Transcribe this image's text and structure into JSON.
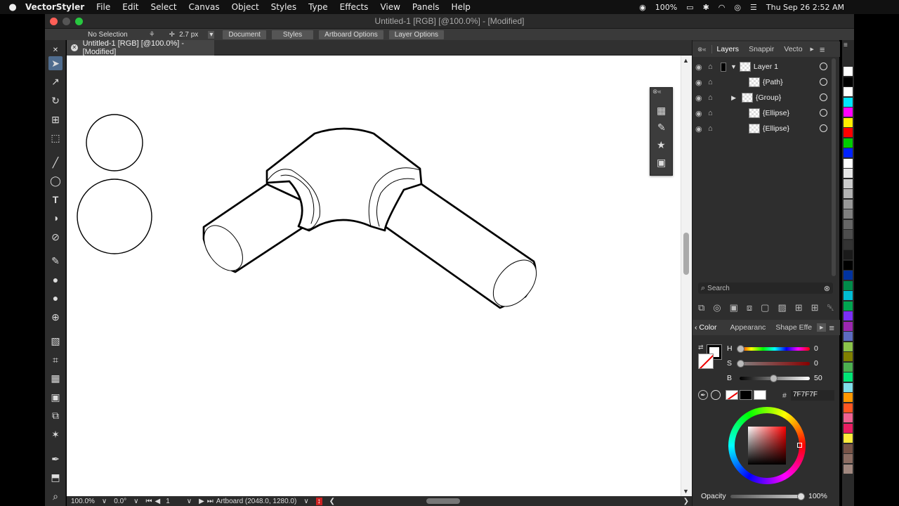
{
  "menubar": {
    "apple": "",
    "items": [
      "VectorStyler",
      "File",
      "Edit",
      "Select",
      "Canvas",
      "Object",
      "Styles",
      "Type",
      "Effects",
      "View",
      "Panels",
      "Help"
    ],
    "battery": "100%",
    "clock": "Thu Sep 26  2:52 AM"
  },
  "window": {
    "title": "Untitled-1 [RGB] [@100.0%] - [Modified]"
  },
  "controlbar": {
    "selection": "No Selection",
    "stroke_width": "2.7 px",
    "buttons": [
      "Document",
      "Styles",
      "Artboard Options",
      "Layer Options"
    ]
  },
  "document_tab": {
    "label": "Untitled-1 [RGB] [@100.0%] - [Modified]"
  },
  "layers_panel": {
    "tabs": [
      "Layers",
      "Snappir",
      "Vecto"
    ],
    "rows": [
      {
        "name": "Layer 1"
      },
      {
        "name": "{Path}"
      },
      {
        "name": "{Group}"
      },
      {
        "name": "{Ellipse}"
      },
      {
        "name": "{Ellipse}"
      }
    ],
    "search_placeholder": "Search"
  },
  "color_panel": {
    "tabs": [
      "Color",
      "Appearanc",
      "Shape Effe"
    ],
    "h_label": "H",
    "h_value": "0",
    "s_label": "S",
    "s_value": "0",
    "b_label": "B",
    "b_value": "50",
    "hex_label": "#",
    "hex": "7F7F7F",
    "opacity_label": "Opacity",
    "opacity": "100%"
  },
  "statusbar": {
    "zoom": "100.0%",
    "rotation": "0.0°",
    "artboard_index": "1",
    "artboard_info": "Artboard (2048.0, 1280.0)"
  },
  "swatch_colors": [
    "#ffffff",
    "#000000",
    "#ffffff",
    "#00e5ff",
    "#ff00ff",
    "#ffee00",
    "#ff0000",
    "#00cc00",
    "#0022ff",
    "#ffffff",
    "#e6e6e6",
    "#cccccc",
    "#b3b3b3",
    "#999999",
    "#808080",
    "#666666",
    "#4d4d4d",
    "#333333",
    "#1a1a1a",
    "#000000",
    "#0033a0",
    "#008c4a",
    "#00bcd4",
    "#00a651",
    "#7b2ff7",
    "#9c27b0",
    "#5c6bc0",
    "#8bc34a",
    "#808000",
    "#4caf50",
    "#00e676",
    "#80deea",
    "#ff9800",
    "#ff5722",
    "#f06292",
    "#e91e63",
    "#ffeb3b",
    "#795548",
    "#8d6e63",
    "#a1887f"
  ]
}
